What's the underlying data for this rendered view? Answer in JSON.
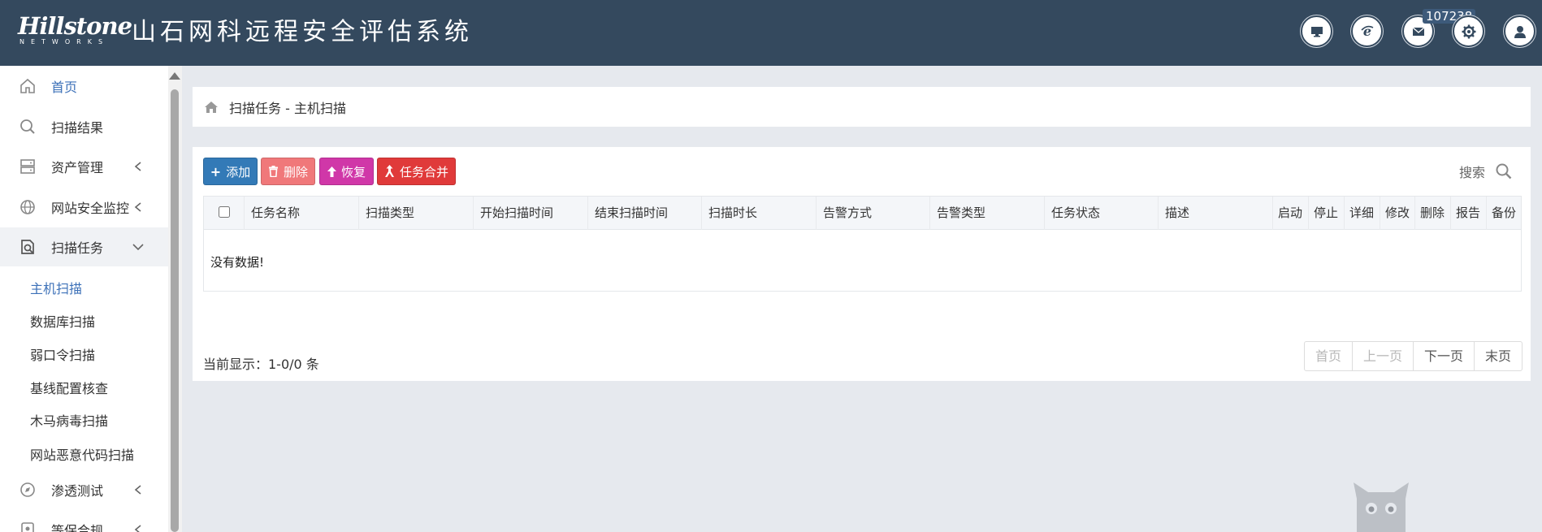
{
  "header": {
    "logo_main": "Hillstone",
    "logo_sub": "NETWORKS",
    "title": "山石网科远程安全评估系统",
    "badge_count": "107238",
    "icons": [
      "monitor-icon",
      "ie-icon",
      "mail-icon",
      "gear-icon",
      "user-icon"
    ]
  },
  "sidebar": {
    "items": [
      {
        "label": "首页",
        "icon": "home-icon",
        "active": true
      },
      {
        "label": "扫描结果",
        "icon": "search-icon"
      },
      {
        "label": "资产管理",
        "icon": "server-icon",
        "chevron": "left"
      },
      {
        "label": "网站安全监控",
        "icon": "globe-icon",
        "chevron": "left"
      },
      {
        "label": "扫描任务",
        "icon": "scan-task-icon",
        "chevron": "down",
        "open": true
      },
      {
        "label": "渗透测试",
        "icon": "compass-icon",
        "chevron": "left"
      },
      {
        "label": "等保合规",
        "icon": "shield-icon",
        "chevron": "left"
      }
    ],
    "sub_items": [
      {
        "label": "主机扫描",
        "active": true
      },
      {
        "label": "数据库扫描"
      },
      {
        "label": "弱口令扫描"
      },
      {
        "label": "基线配置核查"
      },
      {
        "label": "木马病毒扫描"
      },
      {
        "label": "网站恶意代码扫描"
      }
    ]
  },
  "breadcrumb": "扫描任务 - 主机扫描",
  "toolbar": {
    "add": "添加",
    "delete": "删除",
    "restore": "恢复",
    "merge": "任务合并",
    "search": "搜索"
  },
  "table": {
    "columns": [
      "任务名称",
      "扫描类型",
      "开始扫描时间",
      "结束扫描时间",
      "扫描时长",
      "告警方式",
      "告警类型",
      "任务状态",
      "描述",
      "启动",
      "停止",
      "详细",
      "修改",
      "删除",
      "报告",
      "备份"
    ],
    "empty_text": "没有数据!"
  },
  "footer": {
    "status": "当前显示：1-0/0 条",
    "pager": [
      "首页",
      "上一页",
      "下一页",
      "末页"
    ]
  },
  "colors": {
    "header_bg": "#34495e",
    "accent": "#3d71b8",
    "add": "#337ab7",
    "delete": "#f0787a",
    "restore": "#d037a8",
    "merge": "#e03a3a"
  }
}
